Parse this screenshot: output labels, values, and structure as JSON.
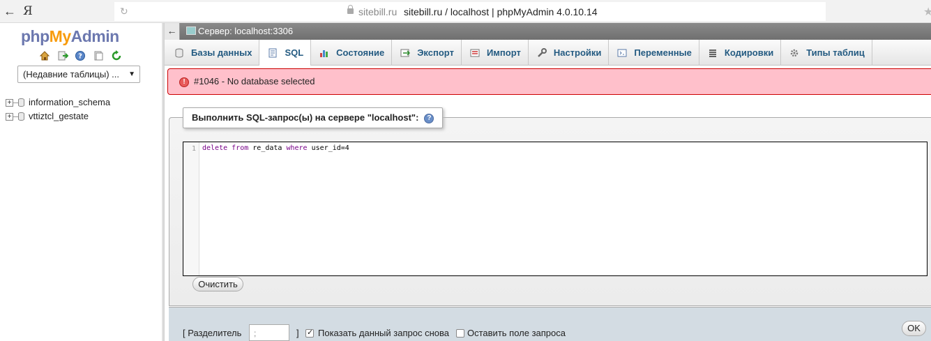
{
  "browser": {
    "domain": "sitebill.ru",
    "title": "sitebill.ru / localhost | phpMyAdmin 4.0.10.14",
    "ya_label": "Я"
  },
  "logo": {
    "part1": "php",
    "part2": "My",
    "part3": "Admin"
  },
  "left_panel": {
    "recent_tables": "(Недавние таблицы) ...",
    "databases": [
      {
        "name": "information_schema"
      },
      {
        "name": "vttiztcl_gestate"
      }
    ]
  },
  "server_bar": {
    "label": "Сервер: localhost:3306"
  },
  "tabs": [
    {
      "label": "Базы данных",
      "icon": "databases-icon"
    },
    {
      "label": "SQL",
      "icon": "sql-icon",
      "active": true
    },
    {
      "label": "Состояние",
      "icon": "status-icon"
    },
    {
      "label": "Экспорт",
      "icon": "export-icon"
    },
    {
      "label": "Импорт",
      "icon": "import-icon"
    },
    {
      "label": "Настройки",
      "icon": "settings-icon"
    },
    {
      "label": "Переменные",
      "icon": "variables-icon"
    },
    {
      "label": "Кодировки",
      "icon": "charsets-icon"
    },
    {
      "label": "Типы таблиц",
      "icon": "engines-icon"
    }
  ],
  "error": {
    "message": "#1046 - No database selected"
  },
  "query_panel": {
    "legend": "Выполнить SQL-запрос(ы) на сервере \"localhost\":",
    "line_number": "1",
    "code_parts": [
      "delete",
      "from",
      "re_data",
      "where",
      "user_id=4"
    ],
    "clear_label": "Очистить"
  },
  "bottom": {
    "delimiter_label": "[ Разделитель",
    "delimiter_value": ";",
    "delimiter_end": "]",
    "show_query_label": "Показать данный запрос снова",
    "show_query_checked": true,
    "retain_box_label": "Оставить поле запроса",
    "retain_box_checked": false,
    "ok_label": "OK"
  }
}
